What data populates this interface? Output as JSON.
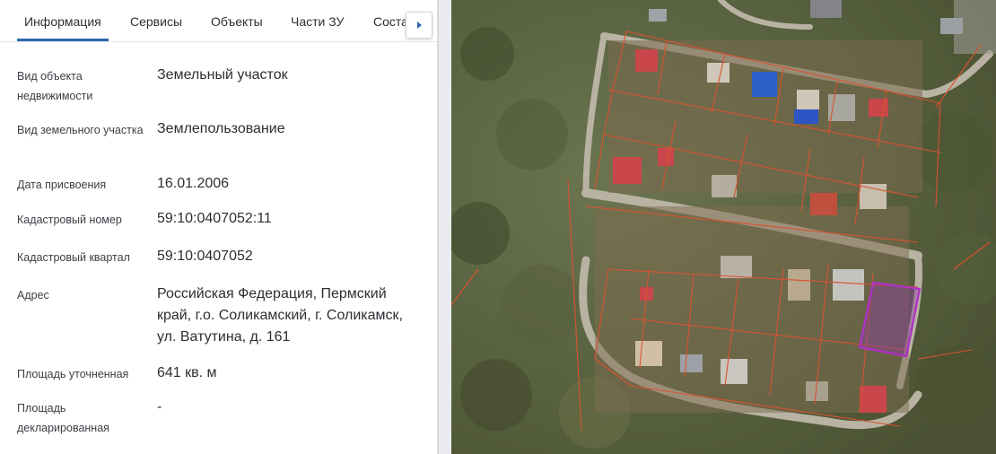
{
  "tabs": [
    {
      "label": "Информация",
      "active": true
    },
    {
      "label": "Сервисы",
      "active": false
    },
    {
      "label": "Объекты",
      "active": false
    },
    {
      "label": "Части ЗУ",
      "active": false
    },
    {
      "label": "Соста",
      "active": false
    }
  ],
  "tabs_scroll_icon": "chevron-right-icon",
  "fields": [
    {
      "label": "Вид объекта недвижимости",
      "value": "Земельный участок"
    },
    {
      "label": "Вид земельного участка",
      "value": "Землепользование"
    },
    {
      "label": "Дата присвоения",
      "value": "16.01.2006"
    },
    {
      "label": "Кадастровый номер",
      "value": "59:10:0407052:11"
    },
    {
      "label": "Кадастровый квартал",
      "value": "59:10:0407052"
    },
    {
      "label": "Адрес",
      "value": "Российская Федерация, Пермский край, г.о. Соликамский, г. Соликамск, ул. Ватутина, д. 161"
    },
    {
      "label": "Площадь уточненная",
      "value": "641 кв. м"
    },
    {
      "label": "Площадь декларированная",
      "value": "-"
    }
  ],
  "colors": {
    "accent": "#2f67b0",
    "parcel_boundary": "#d9532f",
    "selected_parcel": "#b030c8"
  }
}
